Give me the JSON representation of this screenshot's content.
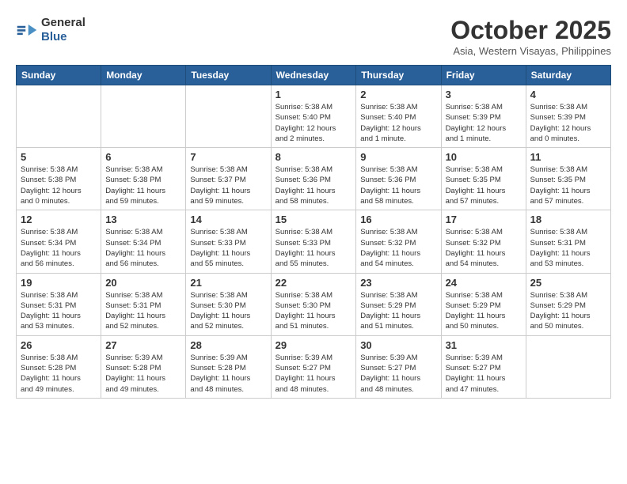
{
  "header": {
    "logo_general": "General",
    "logo_blue": "Blue",
    "title": "October 2025",
    "subtitle": "Asia, Western Visayas, Philippines"
  },
  "weekdays": [
    "Sunday",
    "Monday",
    "Tuesday",
    "Wednesday",
    "Thursday",
    "Friday",
    "Saturday"
  ],
  "weeks": [
    [
      {
        "day": "",
        "info": ""
      },
      {
        "day": "",
        "info": ""
      },
      {
        "day": "",
        "info": ""
      },
      {
        "day": "1",
        "info": "Sunrise: 5:38 AM\nSunset: 5:40 PM\nDaylight: 12 hours\nand 2 minutes."
      },
      {
        "day": "2",
        "info": "Sunrise: 5:38 AM\nSunset: 5:40 PM\nDaylight: 12 hours\nand 1 minute."
      },
      {
        "day": "3",
        "info": "Sunrise: 5:38 AM\nSunset: 5:39 PM\nDaylight: 12 hours\nand 1 minute."
      },
      {
        "day": "4",
        "info": "Sunrise: 5:38 AM\nSunset: 5:39 PM\nDaylight: 12 hours\nand 0 minutes."
      }
    ],
    [
      {
        "day": "5",
        "info": "Sunrise: 5:38 AM\nSunset: 5:38 PM\nDaylight: 12 hours\nand 0 minutes."
      },
      {
        "day": "6",
        "info": "Sunrise: 5:38 AM\nSunset: 5:38 PM\nDaylight: 11 hours\nand 59 minutes."
      },
      {
        "day": "7",
        "info": "Sunrise: 5:38 AM\nSunset: 5:37 PM\nDaylight: 11 hours\nand 59 minutes."
      },
      {
        "day": "8",
        "info": "Sunrise: 5:38 AM\nSunset: 5:36 PM\nDaylight: 11 hours\nand 58 minutes."
      },
      {
        "day": "9",
        "info": "Sunrise: 5:38 AM\nSunset: 5:36 PM\nDaylight: 11 hours\nand 58 minutes."
      },
      {
        "day": "10",
        "info": "Sunrise: 5:38 AM\nSunset: 5:35 PM\nDaylight: 11 hours\nand 57 minutes."
      },
      {
        "day": "11",
        "info": "Sunrise: 5:38 AM\nSunset: 5:35 PM\nDaylight: 11 hours\nand 57 minutes."
      }
    ],
    [
      {
        "day": "12",
        "info": "Sunrise: 5:38 AM\nSunset: 5:34 PM\nDaylight: 11 hours\nand 56 minutes."
      },
      {
        "day": "13",
        "info": "Sunrise: 5:38 AM\nSunset: 5:34 PM\nDaylight: 11 hours\nand 56 minutes."
      },
      {
        "day": "14",
        "info": "Sunrise: 5:38 AM\nSunset: 5:33 PM\nDaylight: 11 hours\nand 55 minutes."
      },
      {
        "day": "15",
        "info": "Sunrise: 5:38 AM\nSunset: 5:33 PM\nDaylight: 11 hours\nand 55 minutes."
      },
      {
        "day": "16",
        "info": "Sunrise: 5:38 AM\nSunset: 5:32 PM\nDaylight: 11 hours\nand 54 minutes."
      },
      {
        "day": "17",
        "info": "Sunrise: 5:38 AM\nSunset: 5:32 PM\nDaylight: 11 hours\nand 54 minutes."
      },
      {
        "day": "18",
        "info": "Sunrise: 5:38 AM\nSunset: 5:31 PM\nDaylight: 11 hours\nand 53 minutes."
      }
    ],
    [
      {
        "day": "19",
        "info": "Sunrise: 5:38 AM\nSunset: 5:31 PM\nDaylight: 11 hours\nand 53 minutes."
      },
      {
        "day": "20",
        "info": "Sunrise: 5:38 AM\nSunset: 5:31 PM\nDaylight: 11 hours\nand 52 minutes."
      },
      {
        "day": "21",
        "info": "Sunrise: 5:38 AM\nSunset: 5:30 PM\nDaylight: 11 hours\nand 52 minutes."
      },
      {
        "day": "22",
        "info": "Sunrise: 5:38 AM\nSunset: 5:30 PM\nDaylight: 11 hours\nand 51 minutes."
      },
      {
        "day": "23",
        "info": "Sunrise: 5:38 AM\nSunset: 5:29 PM\nDaylight: 11 hours\nand 51 minutes."
      },
      {
        "day": "24",
        "info": "Sunrise: 5:38 AM\nSunset: 5:29 PM\nDaylight: 11 hours\nand 50 minutes."
      },
      {
        "day": "25",
        "info": "Sunrise: 5:38 AM\nSunset: 5:29 PM\nDaylight: 11 hours\nand 50 minutes."
      }
    ],
    [
      {
        "day": "26",
        "info": "Sunrise: 5:38 AM\nSunset: 5:28 PM\nDaylight: 11 hours\nand 49 minutes."
      },
      {
        "day": "27",
        "info": "Sunrise: 5:39 AM\nSunset: 5:28 PM\nDaylight: 11 hours\nand 49 minutes."
      },
      {
        "day": "28",
        "info": "Sunrise: 5:39 AM\nSunset: 5:28 PM\nDaylight: 11 hours\nand 48 minutes."
      },
      {
        "day": "29",
        "info": "Sunrise: 5:39 AM\nSunset: 5:27 PM\nDaylight: 11 hours\nand 48 minutes."
      },
      {
        "day": "30",
        "info": "Sunrise: 5:39 AM\nSunset: 5:27 PM\nDaylight: 11 hours\nand 48 minutes."
      },
      {
        "day": "31",
        "info": "Sunrise: 5:39 AM\nSunset: 5:27 PM\nDaylight: 11 hours\nand 47 minutes."
      },
      {
        "day": "",
        "info": ""
      }
    ]
  ]
}
